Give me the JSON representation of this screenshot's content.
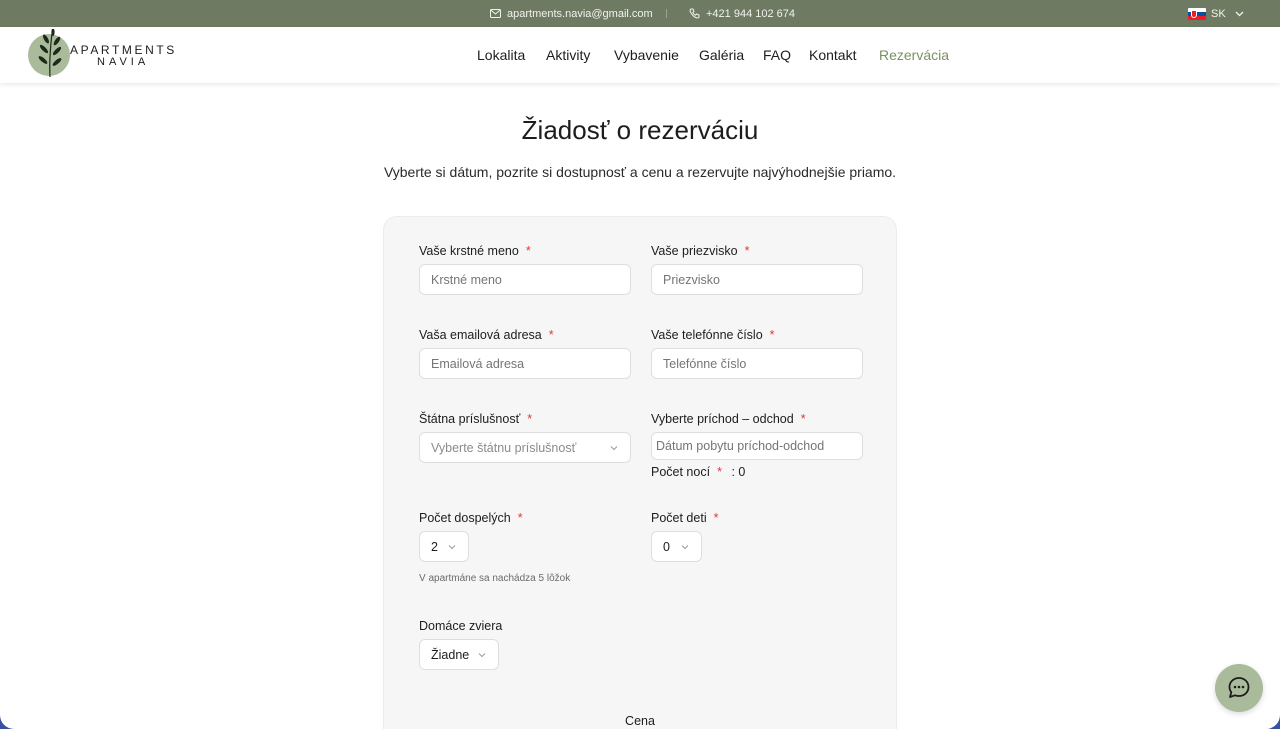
{
  "topbar": {
    "email": "apartments.navia@gmail.com",
    "phone": "+421 944 102 674",
    "language": "SK"
  },
  "logo": {
    "line1": "APARTMENTS",
    "line2": "NAVIA"
  },
  "nav": {
    "items": [
      "Lokalita",
      "Aktivity",
      "Vybavenie",
      "Galéria",
      "FAQ",
      "Kontakt",
      "Rezervácia"
    ],
    "active_color": "#7a9162"
  },
  "main": {
    "title": "Žiadosť o rezerváciu",
    "subtitle": "Vyberte si dátum, pozrite si dostupnosť a cenu a rezervujte najvýhodnejšie priamo."
  },
  "form": {
    "first_name": {
      "label": "Vaše krstné meno",
      "placeholder": "Krstné meno"
    },
    "last_name": {
      "label": "Vaše priezvisko",
      "placeholder": "Priezvisko"
    },
    "email": {
      "label": "Vaša emailová adresa",
      "placeholder": "Emailová adresa"
    },
    "phone": {
      "label": "Vaše telefónne číslo",
      "placeholder": "Telefónne číslo"
    },
    "nationality": {
      "label": "Štátna príslušnosť",
      "value": "Vyberte štátnu príslušnosť"
    },
    "dates": {
      "label": "Vyberte príchod – odchod",
      "placeholder": "Dátum pobytu príchod-odchod"
    },
    "nights": {
      "label": "Počet nocí",
      "value": ": 0"
    },
    "adults": {
      "label": "Počet dospelých",
      "value": "2",
      "hint": "V apartmáne sa nachádza 5 lôžok"
    },
    "children": {
      "label": "Počet deti",
      "value": "0"
    },
    "pets": {
      "label": "Domáce zviera",
      "value": "Žiadne"
    },
    "price_label": "Cena",
    "required_mark": "*"
  },
  "colors": {
    "topbar_bg": "#6f7a62",
    "accent_green": "#7a9162",
    "logo_circle": "#a9bb9b",
    "required_red": "#e0383e"
  },
  "icons": {
    "email": "mail-icon",
    "phone": "phone-icon",
    "flag": "slovakia-flag-icon",
    "chat": "chat-bubble-icon"
  }
}
